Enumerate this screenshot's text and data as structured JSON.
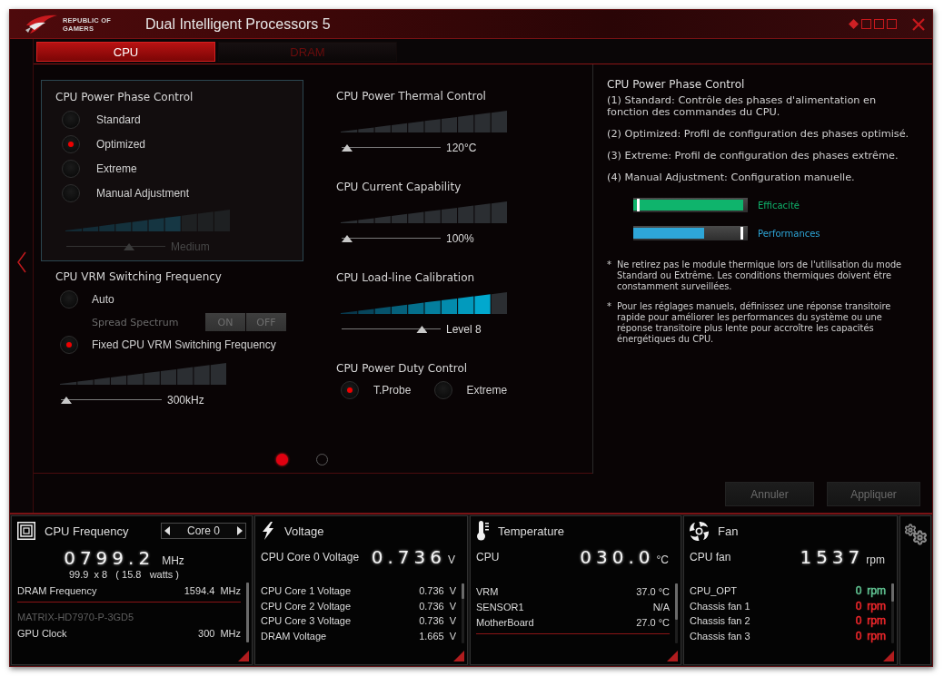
{
  "window": {
    "title": "Dual Intelligent Processors 5",
    "logo_text": [
      "REPUBLIC OF",
      "GAMERS"
    ]
  },
  "tabs": [
    {
      "label": "CPU",
      "selected": true
    },
    {
      "label": "DRAM",
      "selected": false
    }
  ],
  "phase_control": {
    "title": "CPU Power Phase Control",
    "options": [
      {
        "label": "Standard",
        "selected": false
      },
      {
        "label": "Optimized",
        "selected": true
      },
      {
        "label": "Extreme",
        "selected": false
      },
      {
        "label": "Manual Adjustment",
        "selected": false
      }
    ],
    "slider": {
      "disabled": true,
      "level": 0.65,
      "reading": "Medium"
    }
  },
  "vrm_frequency": {
    "title": "CPU VRM Switching Frequency",
    "options": [
      {
        "kind": "radio",
        "label": "Auto",
        "selected": false
      },
      {
        "kind": "toggle",
        "label": "Spread Spectrum",
        "disabled": true,
        "choices": [
          "ON",
          "OFF"
        ]
      },
      {
        "kind": "radio",
        "label": "Fixed CPU VRM Switching Frequency",
        "selected": true
      }
    ],
    "slider": {
      "level": 0,
      "reading": "300kHz"
    }
  },
  "controls": [
    {
      "kind": "slider",
      "title": "CPU Power Thermal Control",
      "level": 0,
      "reading": "120°C"
    },
    {
      "kind": "slider",
      "title": "CPU Current Capability",
      "level": 0,
      "reading": "100%"
    },
    {
      "kind": "slider",
      "title": "CPU Load-line Calibration",
      "level": 0.85,
      "reading": "Level 8"
    },
    {
      "kind": "radios",
      "title": "CPU Power Duty Control",
      "options": [
        {
          "label": "T.Probe",
          "selected": true
        },
        {
          "label": "Extreme",
          "selected": false
        }
      ]
    }
  ],
  "pager": [
    {
      "selected": true
    },
    {
      "selected": false
    }
  ],
  "help": {
    "title": "CPU Power Phase Control",
    "paragraphs": [
      "(1) Standard: Contrôle des phases d'alimentation en fonction des commandes du CPU.",
      "(2) Optimized: Profil de configuration des phases optimisé.",
      "(3) Extreme: Profil de configuration des phases extrême.",
      "(4) Manual Adjustment: Configuration manuelle."
    ],
    "meters": [
      {
        "kind": "efficiency",
        "label": "Efficacité",
        "level": 0.96,
        "color": "#0fb46c"
      },
      {
        "kind": "performance",
        "label": "Performances",
        "level": 0.62,
        "color": "#2ea6d8"
      }
    ],
    "notes": [
      {
        "bullet": "*",
        "text": "Ne retirez pas le module thermique lors de l'utilisation du mode Standard ou Extrême. Les conditions thermiques doivent être constamment surveillées."
      },
      {
        "bullet": "*",
        "text": "Pour les réglages manuels, définissez une réponse transitoire rapide pour améliorer les performances du système ou une réponse transitoire plus lente pour accroître les capacités énergétiques du CPU."
      }
    ]
  },
  "buttons": [
    {
      "label": "Annuler",
      "disabled": true
    },
    {
      "label": "Appliquer",
      "disabled": true
    }
  ],
  "monitors": [
    {
      "kind": "cpu",
      "title": "CPU Frequency",
      "selector": "Core 0",
      "reading": {
        "value": "0799.2",
        "unit": "MHz"
      },
      "detail": "99.9  x 8   ( 15.8   watts )",
      "rows": [
        {
          "kind": "row",
          "label": "DRAM Frequency",
          "value": "1594.4",
          "unit": "MHz"
        },
        {
          "kind": "divider"
        },
        {
          "kind": "device",
          "label": "MATRIX-HD7970-P-3GD5"
        },
        {
          "kind": "row",
          "label": "GPU Clock",
          "value": "300",
          "unit": "MHz"
        }
      ]
    },
    {
      "kind": "voltage",
      "title": "Voltage",
      "reading": {
        "label": "CPU Core 0 Voltage",
        "value": "0.736",
        "unit": "V"
      },
      "rows": [
        {
          "kind": "row",
          "label": "CPU Core 1 Voltage",
          "value": "0.736",
          "unit": "V"
        },
        {
          "kind": "row",
          "label": "CPU Core 2 Voltage",
          "value": "0.736",
          "unit": "V"
        },
        {
          "kind": "row",
          "label": "CPU Core 3 Voltage",
          "value": "0.736",
          "unit": "V"
        },
        {
          "kind": "row",
          "label": "DRAM Voltage",
          "value": "1.665",
          "unit": "V"
        }
      ]
    },
    {
      "kind": "temperature",
      "title": "Temperature",
      "reading": {
        "label": "CPU",
        "value": "030.0",
        "unit": "°C"
      },
      "rows": [
        {
          "kind": "row",
          "label": "VRM",
          "value": "37.0 °C"
        },
        {
          "kind": "row",
          "label": "SENSOR1",
          "value": "N/A"
        },
        {
          "kind": "row",
          "label": "MotherBoard",
          "value": "27.0 °C"
        },
        {
          "kind": "divider"
        }
      ]
    },
    {
      "kind": "fan",
      "title": "Fan",
      "reading": {
        "label": "CPU fan",
        "value": "1537",
        "unit": "rpm"
      },
      "rows": [
        {
          "kind": "row",
          "label": "CPU_OPT",
          "value": "0",
          "unit": "rpm",
          "color": "#5fbf8f"
        },
        {
          "kind": "row",
          "label": "Chassis fan 1",
          "value": "0",
          "unit": "rpm",
          "color": "#e8262a"
        },
        {
          "kind": "row",
          "label": "Chassis fan 2",
          "value": "0",
          "unit": "rpm",
          "color": "#e8262a"
        },
        {
          "kind": "row",
          "label": "Chassis fan 3",
          "value": "0",
          "unit": "rpm",
          "color": "#e8262a"
        }
      ]
    }
  ]
}
